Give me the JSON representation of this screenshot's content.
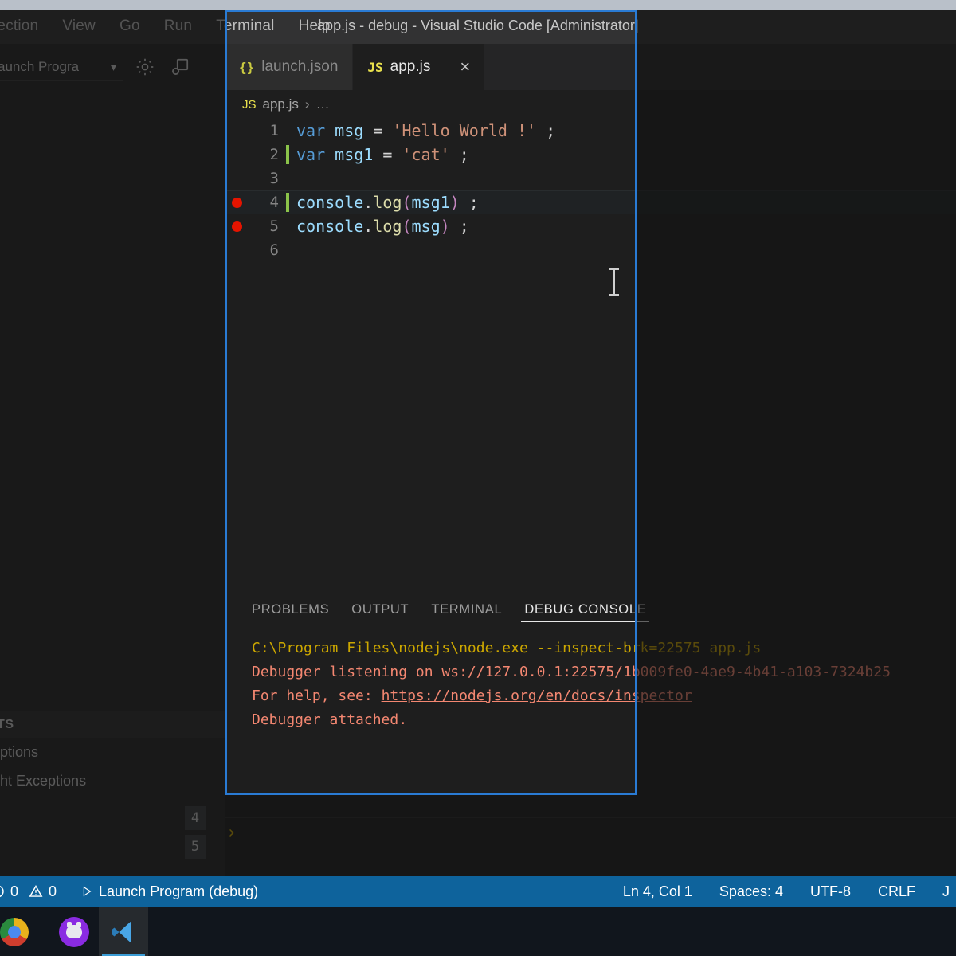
{
  "window": {
    "title": "app.js - debug - Visual Studio Code [Administrator]"
  },
  "menubar": {
    "items": [
      {
        "label": "lection"
      },
      {
        "label": "View"
      },
      {
        "label": "Go"
      },
      {
        "label": "Run"
      },
      {
        "label": "Terminal"
      },
      {
        "label": "Help"
      }
    ]
  },
  "sidebar": {
    "launch_config": "aunch Progra",
    "gear_icon": "gear-icon",
    "open_config_icon": "open-debug-config-icon",
    "breakpoints_header": "TS",
    "breakpoints": [
      {
        "label": "eptions"
      },
      {
        "label": "ght Exceptions"
      }
    ],
    "breakpoint_line_numbers": [
      "4",
      "5"
    ]
  },
  "editor": {
    "tabs": [
      {
        "label": "launch.json",
        "icon": "json-file-icon",
        "icon_glyph": "{}",
        "active": false
      },
      {
        "label": "app.js",
        "icon": "js-file-icon",
        "icon_glyph": "JS",
        "active": true
      }
    ],
    "close_glyph": "×",
    "breadcrumb": {
      "icon_glyph": "JS",
      "file": "app.js",
      "separator": "›",
      "dots": "…"
    },
    "lines": [
      {
        "number": "1",
        "breakpoint": false,
        "modified": false,
        "current": false,
        "tokens": [
          {
            "t": "var",
            "c": "tk-kw"
          },
          {
            "t": " ",
            "c": "tk-op"
          },
          {
            "t": "msg",
            "c": "tk-var"
          },
          {
            "t": " = ",
            "c": "tk-op"
          },
          {
            "t": "'Hello World !'",
            "c": "tk-str"
          },
          {
            "t": " ;",
            "c": "tk-punc"
          }
        ]
      },
      {
        "number": "2",
        "breakpoint": false,
        "modified": true,
        "current": false,
        "tokens": [
          {
            "t": "var",
            "c": "tk-kw"
          },
          {
            "t": " ",
            "c": "tk-op"
          },
          {
            "t": "msg1",
            "c": "tk-var"
          },
          {
            "t": " = ",
            "c": "tk-op"
          },
          {
            "t": "'cat'",
            "c": "tk-str"
          },
          {
            "t": " ;",
            "c": "tk-punc"
          }
        ]
      },
      {
        "number": "3",
        "breakpoint": false,
        "modified": false,
        "current": false,
        "tokens": []
      },
      {
        "number": "4",
        "breakpoint": true,
        "modified": true,
        "current": true,
        "tokens": [
          {
            "t": "console",
            "c": "tk-obj"
          },
          {
            "t": ".",
            "c": "tk-punc"
          },
          {
            "t": "log",
            "c": "tk-fn"
          },
          {
            "t": "(",
            "c": "tk-paren"
          },
          {
            "t": "msg1",
            "c": "tk-var"
          },
          {
            "t": ")",
            "c": "tk-paren"
          },
          {
            "t": " ;",
            "c": "tk-punc"
          }
        ]
      },
      {
        "number": "5",
        "breakpoint": true,
        "modified": false,
        "current": false,
        "tokens": [
          {
            "t": "console",
            "c": "tk-obj"
          },
          {
            "t": ".",
            "c": "tk-punc"
          },
          {
            "t": "log",
            "c": "tk-fn"
          },
          {
            "t": "(",
            "c": "tk-paren"
          },
          {
            "t": "msg",
            "c": "tk-var"
          },
          {
            "t": ")",
            "c": "tk-paren"
          },
          {
            "t": " ;",
            "c": "tk-punc"
          }
        ]
      },
      {
        "number": "6",
        "breakpoint": false,
        "modified": false,
        "current": false,
        "tokens": []
      }
    ]
  },
  "panel": {
    "tabs": [
      {
        "label": "PROBLEMS",
        "active": false
      },
      {
        "label": "OUTPUT",
        "active": false
      },
      {
        "label": "TERMINAL",
        "active": false
      },
      {
        "label": "DEBUG CONSOLE",
        "active": true
      }
    ],
    "console_lines": [
      {
        "text": "C:\\Program Files\\nodejs\\node.exe --inspect-brk=22575 app.js",
        "style": "c-warn"
      },
      {
        "text": "Debugger listening on ws://127.0.0.1:22575/1b009fe0-4ae9-4b41-a103-7324b25",
        "style": "c-err"
      },
      {
        "text": "For help, see: ",
        "style": "c-err",
        "link": "https://nodejs.org/en/docs/inspector"
      },
      {
        "text": "Debugger attached.",
        "style": "c-err"
      }
    ],
    "prompt_glyph": "›"
  },
  "statusbar": {
    "errors_icon": "error-circle-icon",
    "errors": "0",
    "warnings_icon": "warning-triangle-icon",
    "warnings": "0",
    "run_icon": "play-icon",
    "launch_label": "Launch Program (debug)",
    "cursor": "Ln 4, Col 1",
    "indent": "Spaces: 4",
    "encoding": "UTF-8",
    "eol": "CRLF",
    "language": "J"
  },
  "taskbar": {
    "apps": [
      {
        "name": "chrome-taskbar-icon",
        "active": false
      },
      {
        "name": "github-desktop-taskbar-icon",
        "active": false
      },
      {
        "name": "vscode-taskbar-icon",
        "active": true
      }
    ]
  },
  "colors": {
    "accent": "#0e639c",
    "highlight_border": "#2a7bd4",
    "breakpoint": "#e51400",
    "modified_gutter": "#8bc34a"
  }
}
